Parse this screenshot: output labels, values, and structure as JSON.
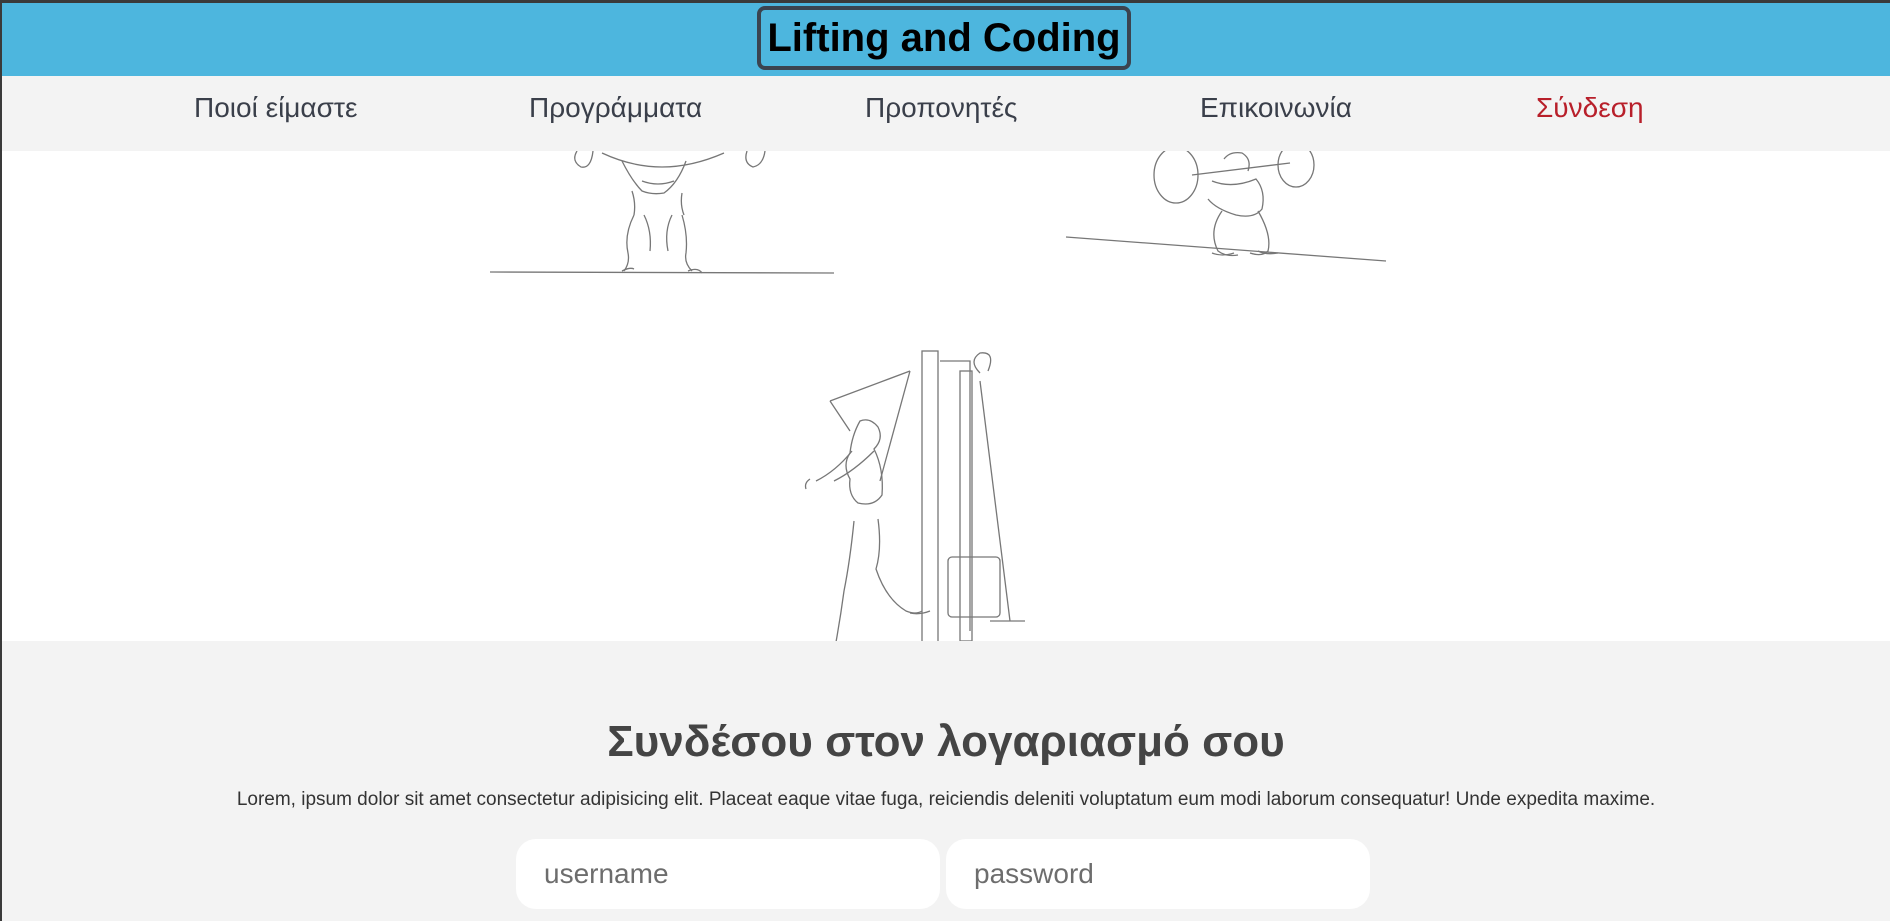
{
  "header": {
    "brand": "Lifting and Coding"
  },
  "nav": {
    "items": [
      {
        "label": "Ποιοί είμαστε"
      },
      {
        "label": "Προγράμματα"
      },
      {
        "label": "Προπονητές"
      },
      {
        "label": "Επικοινωνία"
      },
      {
        "label": "Σύνδεση",
        "active": true
      }
    ]
  },
  "hero": {
    "illustrations": [
      "deadlift-lifter",
      "squat-lifter",
      "cable-machine-lifter"
    ]
  },
  "login": {
    "title": "Συνδέσου στον λογαριασμό σου",
    "description": "Lorem, ipsum dolor sit amet consectetur adipisicing elit. Placeat eaque vitae fuga, reiciendis deleniti voluptatum eum modi laborum consequatur! Unde expedita maxime.",
    "username_placeholder": "username",
    "password_placeholder": "password"
  },
  "colors": {
    "topbar": "#4db6de",
    "brand_border": "#3b4450",
    "nav_bg": "#f3f3f3",
    "nav_text": "#3a3f4a",
    "nav_active": "#b81f2a",
    "section_bg": "#f3f3f3"
  }
}
